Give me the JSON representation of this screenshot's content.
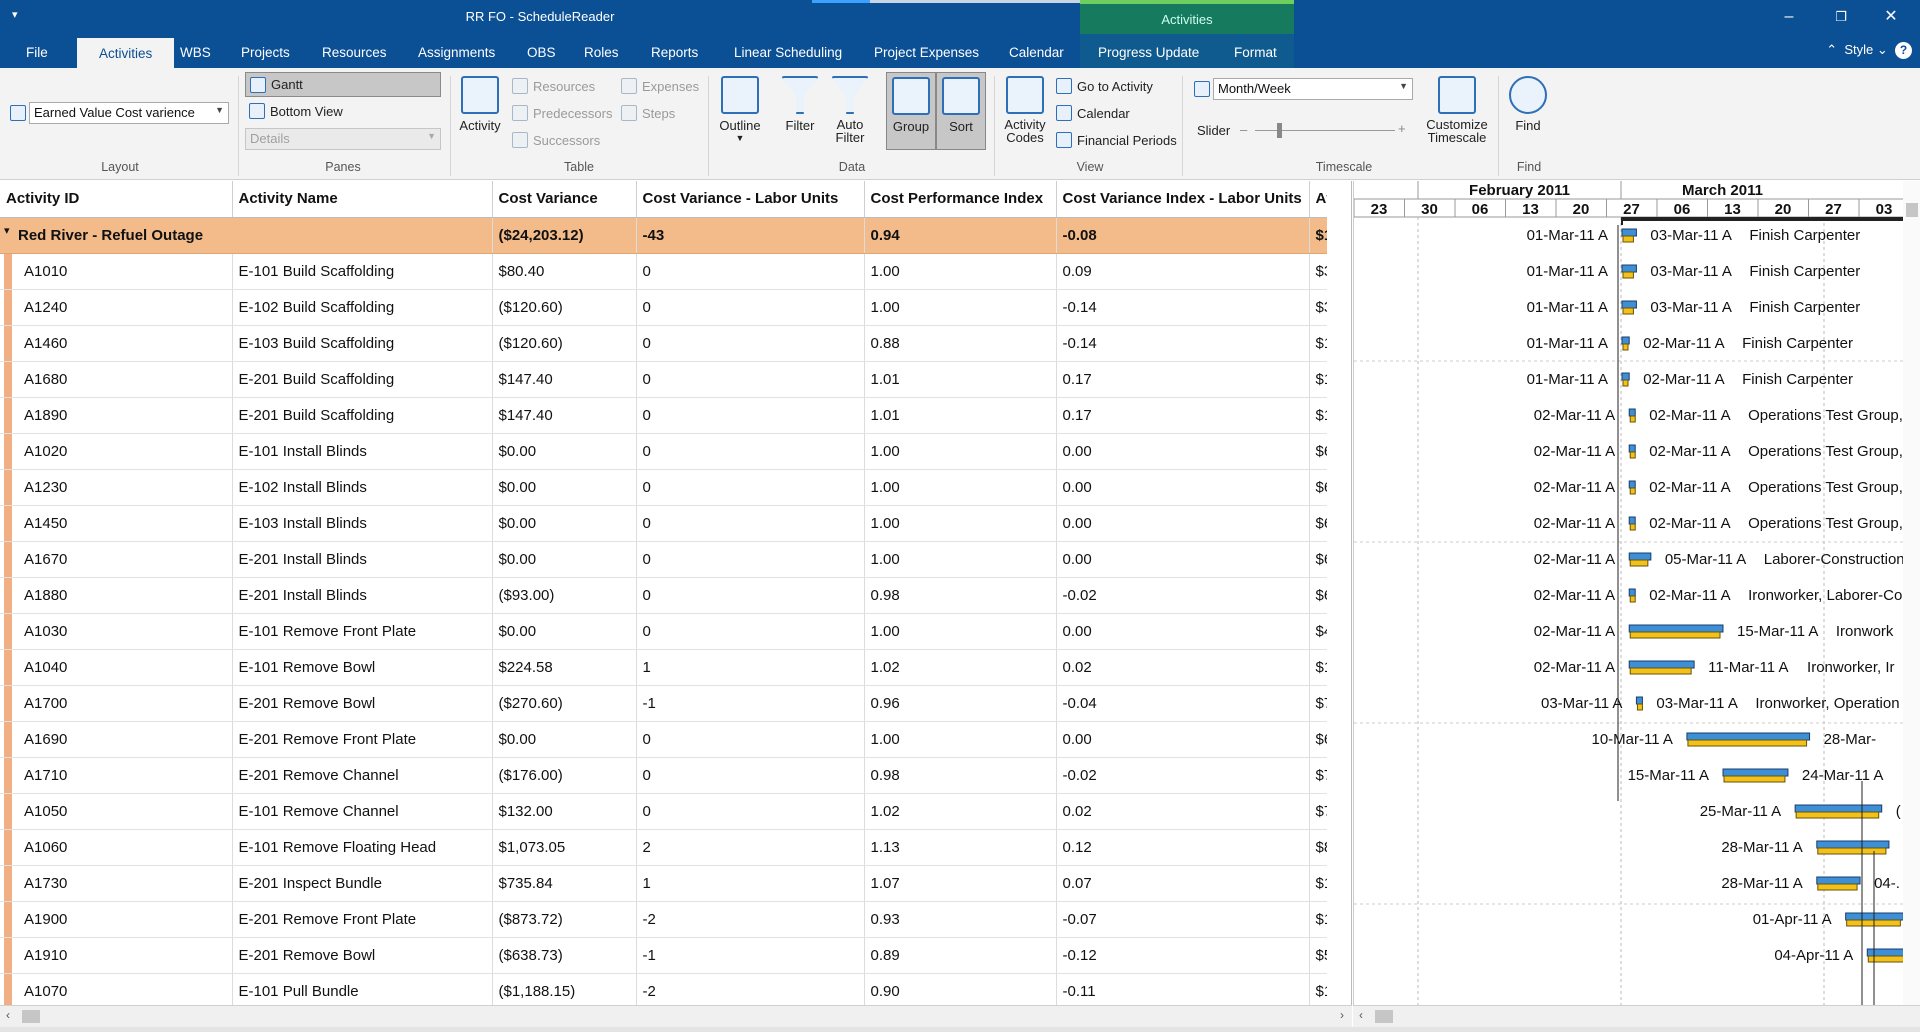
{
  "window": {
    "title": "RR FO - ScheduleReader",
    "context_tab": "Activities"
  },
  "tabs": [
    "File",
    "Activities",
    "WBS",
    "Projects",
    "Resources",
    "Assignments",
    "OBS",
    "Roles",
    "Reports",
    "Linear Scheduling",
    "Project Expenses",
    "Calendar",
    "Progress Update",
    "Format"
  ],
  "active_tab": "Activities",
  "style_label": "Style",
  "ribbon": {
    "layout": {
      "combo": "Earned Value Cost varience",
      "label": "Layout"
    },
    "panes": {
      "gantt": "Gantt",
      "bottom_view": "Bottom View",
      "details": "Details",
      "label": "Panes"
    },
    "table": {
      "activity": "Activity",
      "resources": "Resources",
      "predecessors": "Predecessors",
      "successors": "Successors",
      "expenses": "Expenses",
      "steps": "Steps",
      "label": "Table"
    },
    "data": {
      "outline": "Outline",
      "filter": "Filter",
      "auto_filter_1": "Auto",
      "auto_filter_2": "Filter",
      "group": "Group",
      "sort": "Sort",
      "label": "Data"
    },
    "view": {
      "activity_codes_1": "Activity",
      "activity_codes_2": "Codes",
      "go_to_activity": "Go to Activity",
      "calendar": "Calendar",
      "financial_periods": "Financial Periods",
      "label": "View"
    },
    "timescale": {
      "combo": "Month/Week",
      "slider": "Slider",
      "customize_1": "Customize",
      "customize_2": "Timescale",
      "label": "Timescale"
    },
    "find": {
      "find": "Find",
      "label": "Find"
    }
  },
  "grid": {
    "columns": [
      "Activity ID",
      "Activity Name",
      "Cost Variance",
      "Cost Variance - Labor Units",
      "Cost Performance Index",
      "Cost Variance Index - Labor Units",
      "At"
    ],
    "group": {
      "name": "Red River - Refuel Outage",
      "cv": "($24,203.12)",
      "cvl": "-43",
      "cpi": "0.94",
      "cvil": "-0.08",
      "at": "$1"
    },
    "rows": [
      [
        "A1010",
        "E-101 Build Scaffolding",
        "$80.40",
        "0",
        "1.00",
        "0.09",
        "$3"
      ],
      [
        "A1240",
        "E-102 Build Scaffolding",
        "($120.60)",
        "0",
        "1.00",
        "-0.14",
        "$3"
      ],
      [
        "A1460",
        "E-103 Build Scaffolding",
        "($120.60)",
        "0",
        "0.88",
        "-0.14",
        "$1"
      ],
      [
        "A1680",
        "E-201 Build Scaffolding",
        "$147.40",
        "0",
        "1.01",
        "0.17",
        "$1"
      ],
      [
        "A1890",
        "E-201 Build Scaffolding",
        "$147.40",
        "0",
        "1.01",
        "0.17",
        "$1"
      ],
      [
        "A1020",
        "E-101 Install Blinds",
        "$0.00",
        "0",
        "1.00",
        "0.00",
        "$6"
      ],
      [
        "A1230",
        "E-102 Install Blinds",
        "$0.00",
        "0",
        "1.00",
        "0.00",
        "$6"
      ],
      [
        "A1450",
        "E-103 Install Blinds",
        "$0.00",
        "0",
        "1.00",
        "0.00",
        "$6"
      ],
      [
        "A1670",
        "E-201 Install Blinds",
        "$0.00",
        "0",
        "1.00",
        "0.00",
        "$6"
      ],
      [
        "A1880",
        "E-201 Install Blinds",
        "($93.00)",
        "0",
        "0.98",
        "-0.02",
        "$6"
      ],
      [
        "A1030",
        "E-101 Remove Front Plate",
        "$0.00",
        "0",
        "1.00",
        "0.00",
        "$4"
      ],
      [
        "A1040",
        "E-101 Remove Bowl",
        "$224.58",
        "1",
        "1.02",
        "0.02",
        "$1"
      ],
      [
        "A1700",
        "E-201 Remove Bowl",
        "($270.60)",
        "-1",
        "0.96",
        "-0.04",
        "$7"
      ],
      [
        "A1690",
        "E-201 Remove Front Plate",
        "$0.00",
        "0",
        "1.00",
        "0.00",
        "$6"
      ],
      [
        "A1710",
        "E-201 Remove Channel",
        "($176.00)",
        "0",
        "0.98",
        "-0.02",
        "$7"
      ],
      [
        "A1050",
        "E-101 Remove Channel",
        "$132.00",
        "0",
        "1.02",
        "0.02",
        "$7"
      ],
      [
        "A1060",
        "E-101 Remove Floating Head",
        "$1,073.05",
        "2",
        "1.13",
        "0.12",
        "$8"
      ],
      [
        "A1730",
        "E-201 Inspect Bundle",
        "$735.84",
        "1",
        "1.07",
        "0.07",
        "$1"
      ],
      [
        "A1900",
        "E-201 Remove Front Plate",
        "($873.72)",
        "-2",
        "0.93",
        "-0.07",
        "$1"
      ],
      [
        "A1910",
        "E-201 Remove Bowl",
        "($638.73)",
        "-1",
        "0.89",
        "-0.12",
        "$5"
      ],
      [
        "A1070",
        "E-101 Pull Bundle",
        "($1,188.15)",
        "-2",
        "0.90",
        "-0.11",
        "$1"
      ]
    ]
  },
  "gantt": {
    "months": [
      "February 2011",
      "March 2011"
    ],
    "weeks": [
      "23",
      "30",
      "06",
      "13",
      "20",
      "27",
      "06",
      "13",
      "20",
      "27",
      "03"
    ],
    "bars": [
      {
        "start": "01-Mar-11 A",
        "finish": "03-Mar-11 A",
        "res": "Finish Carpenter",
        "s": 0,
        "d": 2
      },
      {
        "start": "01-Mar-11 A",
        "finish": "03-Mar-11 A",
        "res": "Finish Carpenter",
        "s": 0,
        "d": 2
      },
      {
        "start": "01-Mar-11 A",
        "finish": "03-Mar-11 A",
        "res": "Finish Carpenter",
        "s": 0,
        "d": 2
      },
      {
        "start": "01-Mar-11 A",
        "finish": "02-Mar-11 A",
        "res": "Finish Carpenter",
        "s": 0,
        "d": 1
      },
      {
        "start": "01-Mar-11 A",
        "finish": "02-Mar-11 A",
        "res": "Finish Carpenter",
        "s": 0,
        "d": 1
      },
      {
        "start": "02-Mar-11 A",
        "finish": "02-Mar-11 A",
        "res": "Operations Test Group,",
        "s": 1,
        "d": 0
      },
      {
        "start": "02-Mar-11 A",
        "finish": "02-Mar-11 A",
        "res": "Operations Test Group,",
        "s": 1,
        "d": 0
      },
      {
        "start": "02-Mar-11 A",
        "finish": "02-Mar-11 A",
        "res": "Operations Test Group,",
        "s": 1,
        "d": 0
      },
      {
        "start": "02-Mar-11 A",
        "finish": "02-Mar-11 A",
        "res": "Operations Test Group,",
        "s": 1,
        "d": 0
      },
      {
        "start": "02-Mar-11 A",
        "finish": "05-Mar-11 A",
        "res": "Laborer-Construction,",
        "s": 1,
        "d": 3
      },
      {
        "start": "02-Mar-11 A",
        "finish": "02-Mar-11 A",
        "res": "Ironworker, Laborer-Co",
        "s": 1,
        "d": 0
      },
      {
        "start": "02-Mar-11 A",
        "finish": "15-Mar-11 A",
        "res": "Ironwork",
        "s": 1,
        "d": 13
      },
      {
        "start": "02-Mar-11 A",
        "finish": "11-Mar-11 A",
        "res": "Ironworker, Ir",
        "s": 1,
        "d": 9
      },
      {
        "start": "03-Mar-11 A",
        "finish": "03-Mar-11 A",
        "res": "Ironworker, Operation",
        "s": 2,
        "d": 0
      },
      {
        "start": "10-Mar-11 A",
        "finish": "28-Mar-",
        "res": "",
        "s": 9,
        "d": 17
      },
      {
        "start": "15-Mar-11 A",
        "finish": "24-Mar-11 A",
        "res": "",
        "s": 14,
        "d": 9
      },
      {
        "start": "25-Mar-11 A",
        "finish": "(",
        "res": "",
        "s": 24,
        "d": 12
      },
      {
        "start": "28-Mar-11 A",
        "finish": "",
        "res": "",
        "s": 27,
        "d": 10
      },
      {
        "start": "28-Mar-11 A",
        "finish": "04-.",
        "res": "",
        "s": 27,
        "d": 6
      },
      {
        "start": "01-Apr-11 A",
        "finish": "",
        "res": "",
        "s": 31,
        "d": 8
      },
      {
        "start": "04-Apr-11 A",
        "finish": "",
        "res": "",
        "s": 34,
        "d": 8
      }
    ]
  }
}
